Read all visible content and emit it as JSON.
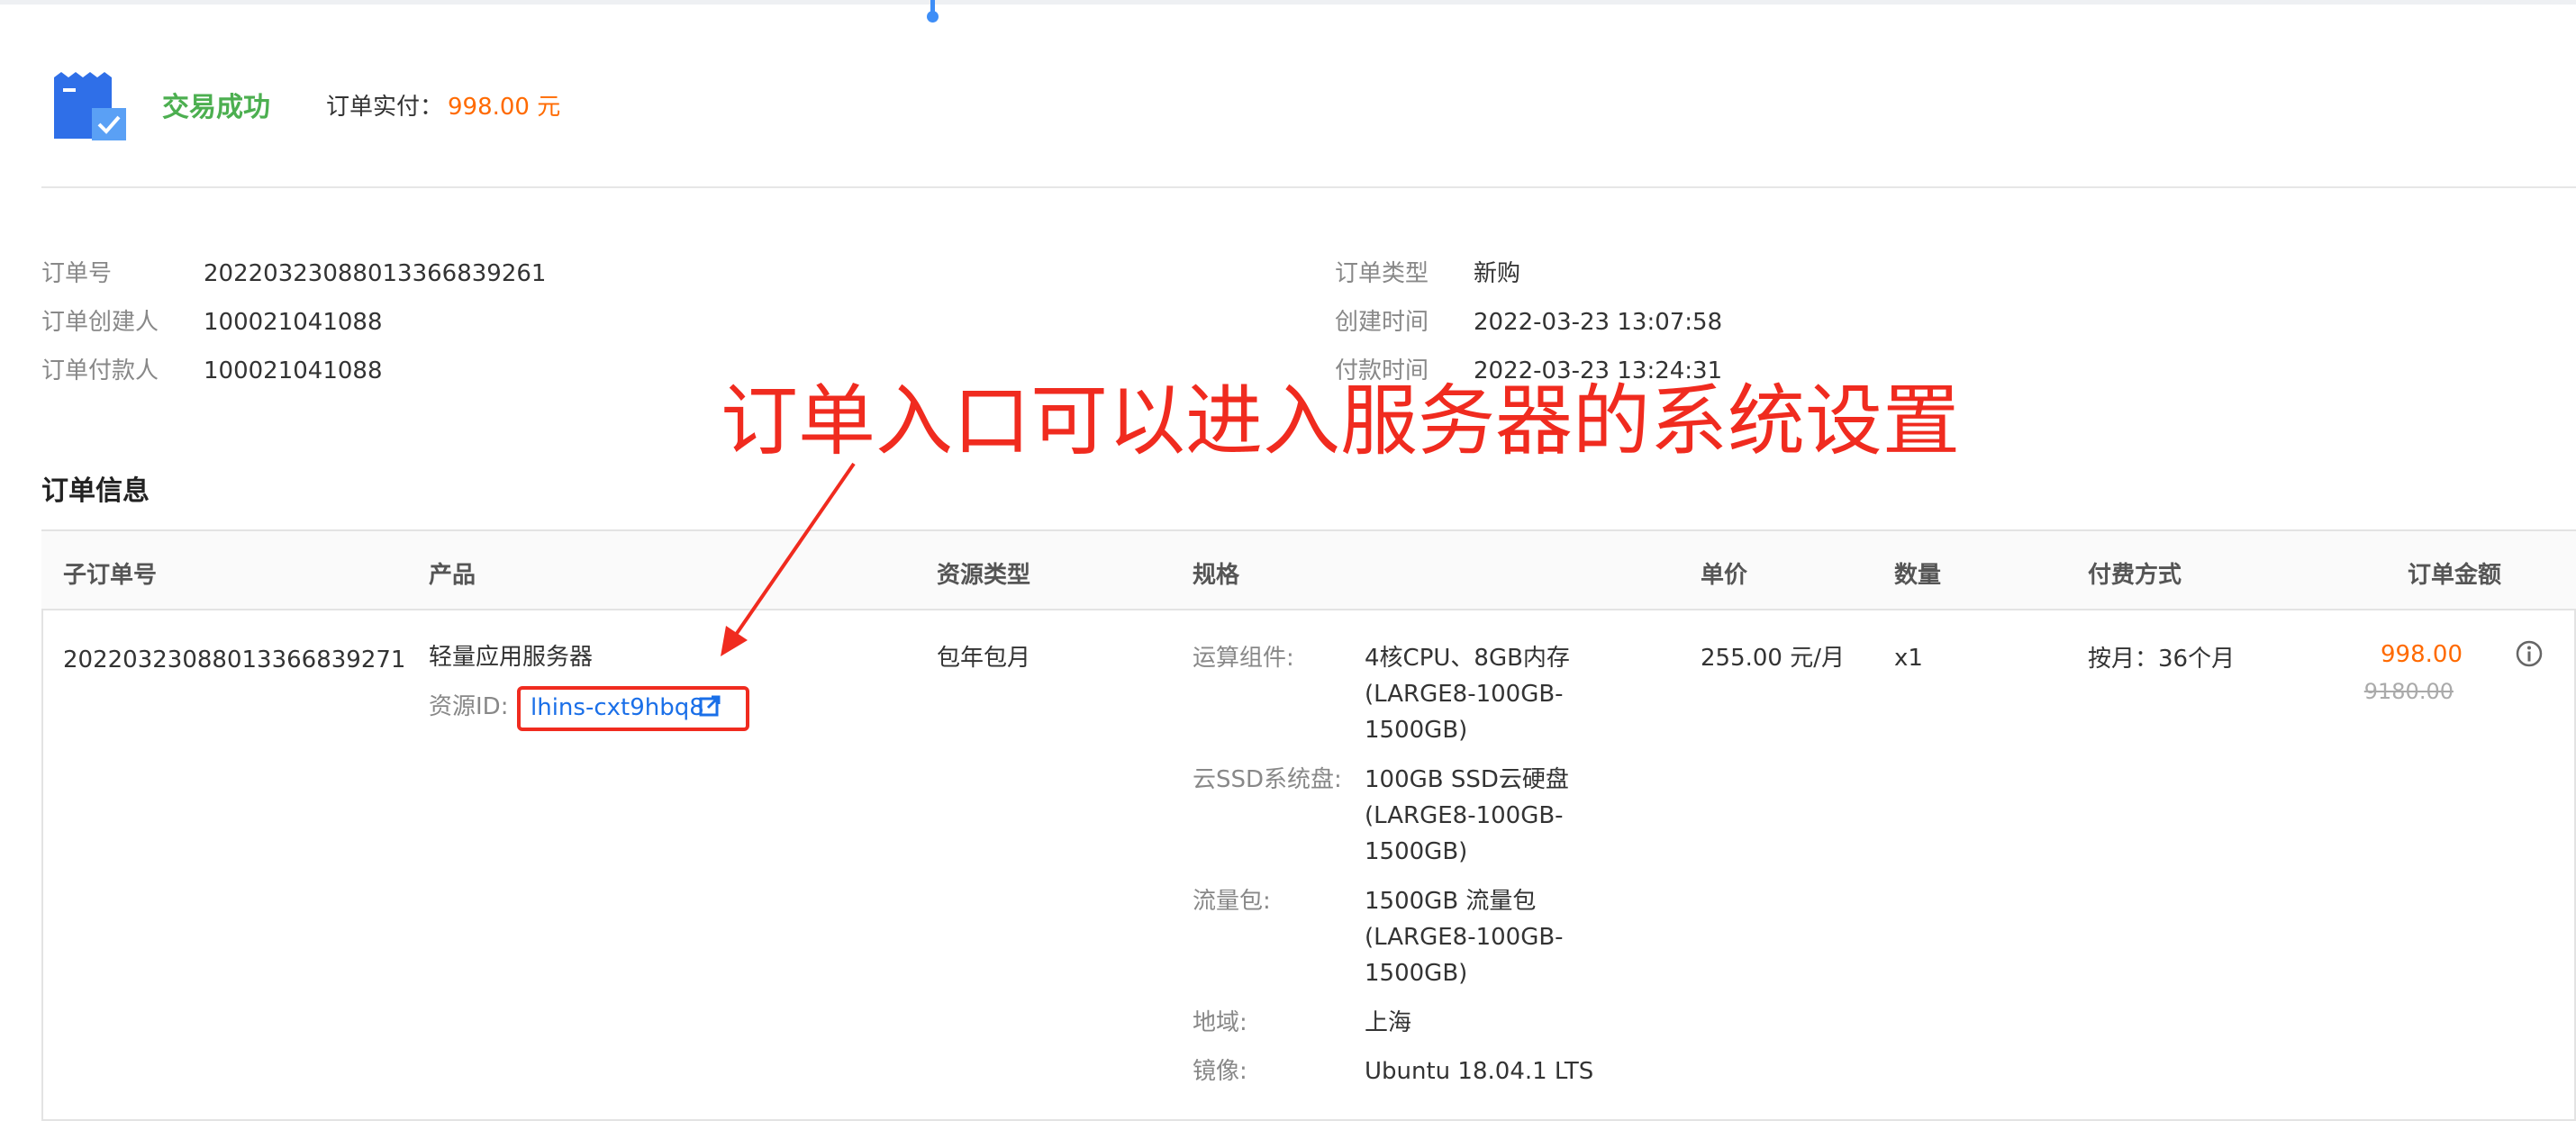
{
  "header": {
    "status": "交易成功",
    "paid_label": "订单实付：",
    "paid_amount": "998.00 元",
    "status_color": "#4caf50",
    "price_color": "#ff6a00",
    "status_icon": "order-receipt-check-icon"
  },
  "meta_left": [
    {
      "label": "订单号",
      "value": "20220323088013366839261"
    },
    {
      "label": "订单创建人",
      "value": "100021041088"
    },
    {
      "label": "订单付款人",
      "value": "100021041088"
    }
  ],
  "meta_right": [
    {
      "label": "订单类型",
      "value": "新购"
    },
    {
      "label": "创建时间",
      "value": "2022-03-23 13:07:58"
    },
    {
      "label": "付款时间",
      "value": "2022-03-23 13:24:31"
    }
  ],
  "annotation": {
    "text": "订单入口可以进入服务器的系统设置",
    "color": "#f02b1f"
  },
  "section_title": "订单信息",
  "table": {
    "headers": [
      "子订单号",
      "产品",
      "资源类型",
      "规格",
      "单价",
      "数量",
      "付费方式",
      "订单金额"
    ],
    "row": {
      "suborder_id": "20220323088013366839271",
      "product": "轻量应用服务器",
      "resource_id_label": "资源ID:",
      "resource_id": "lhins-cxt9hbq8",
      "resource_type": "包年包月",
      "specs": [
        {
          "label": "运算组件:",
          "value": "4核CPU、8GB内存\n(LARGE8-100GB-\n1500GB)"
        },
        {
          "label": "云SSD系统盘:",
          "value": "100GB SSD云硬盘\n(LARGE8-100GB-\n1500GB)"
        },
        {
          "label": "流量包:",
          "value": "1500GB 流量包\n(LARGE8-100GB-\n1500GB)"
        },
        {
          "label": "地域:",
          "value": "上海"
        },
        {
          "label": "镜像:",
          "value": "Ubuntu 18.04.1 LTS"
        }
      ],
      "unit_price": "255.00 元/月",
      "quantity": "x1",
      "billing": "按月：36个月",
      "amount": "998.00",
      "original_amount": "9180.00"
    }
  }
}
